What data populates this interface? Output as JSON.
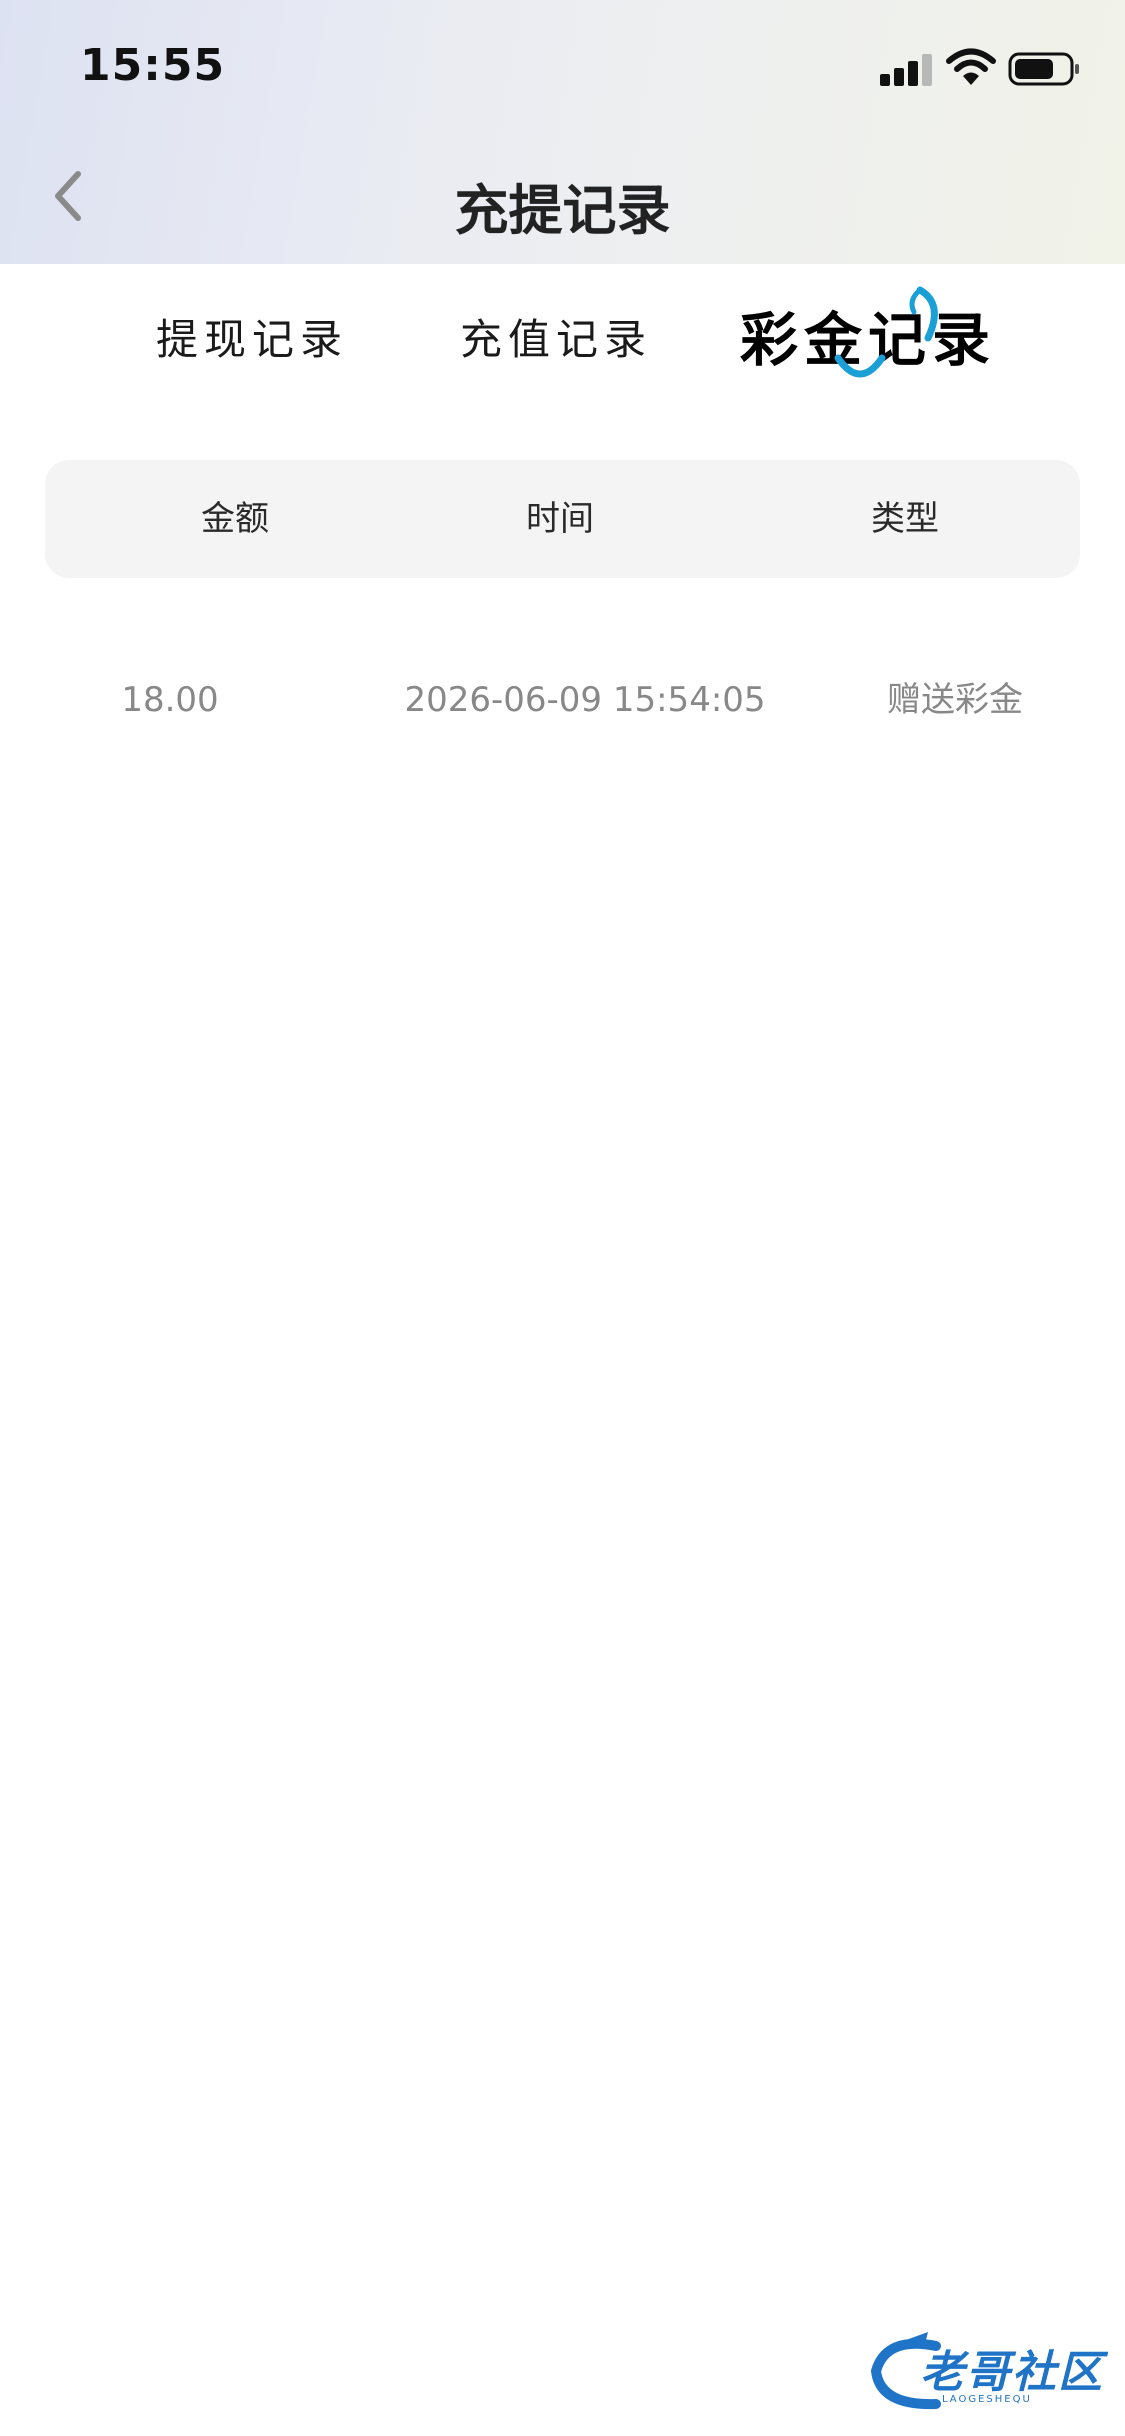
{
  "status_bar": {
    "time": "15:55"
  },
  "nav": {
    "title": "充提记录",
    "back_icon": "chevron-left-icon"
  },
  "tabs": [
    {
      "label": "提现记录",
      "active": false
    },
    {
      "label": "充值记录",
      "active": false
    },
    {
      "label": "彩金记录",
      "active": true
    }
  ],
  "table": {
    "headers": {
      "amount": "金额",
      "time": "时间",
      "type": "类型"
    },
    "rows": [
      {
        "amount": "18.00",
        "time": "2026-06-09 15:54:05",
        "type": "赠送彩金"
      }
    ]
  },
  "watermark": {
    "text": "老哥社区",
    "subtext": "LAOGESHEQU"
  },
  "colors": {
    "accent": "#1a9fd6",
    "row_text": "#888888",
    "table_head_bg": "#f4f4f4"
  }
}
